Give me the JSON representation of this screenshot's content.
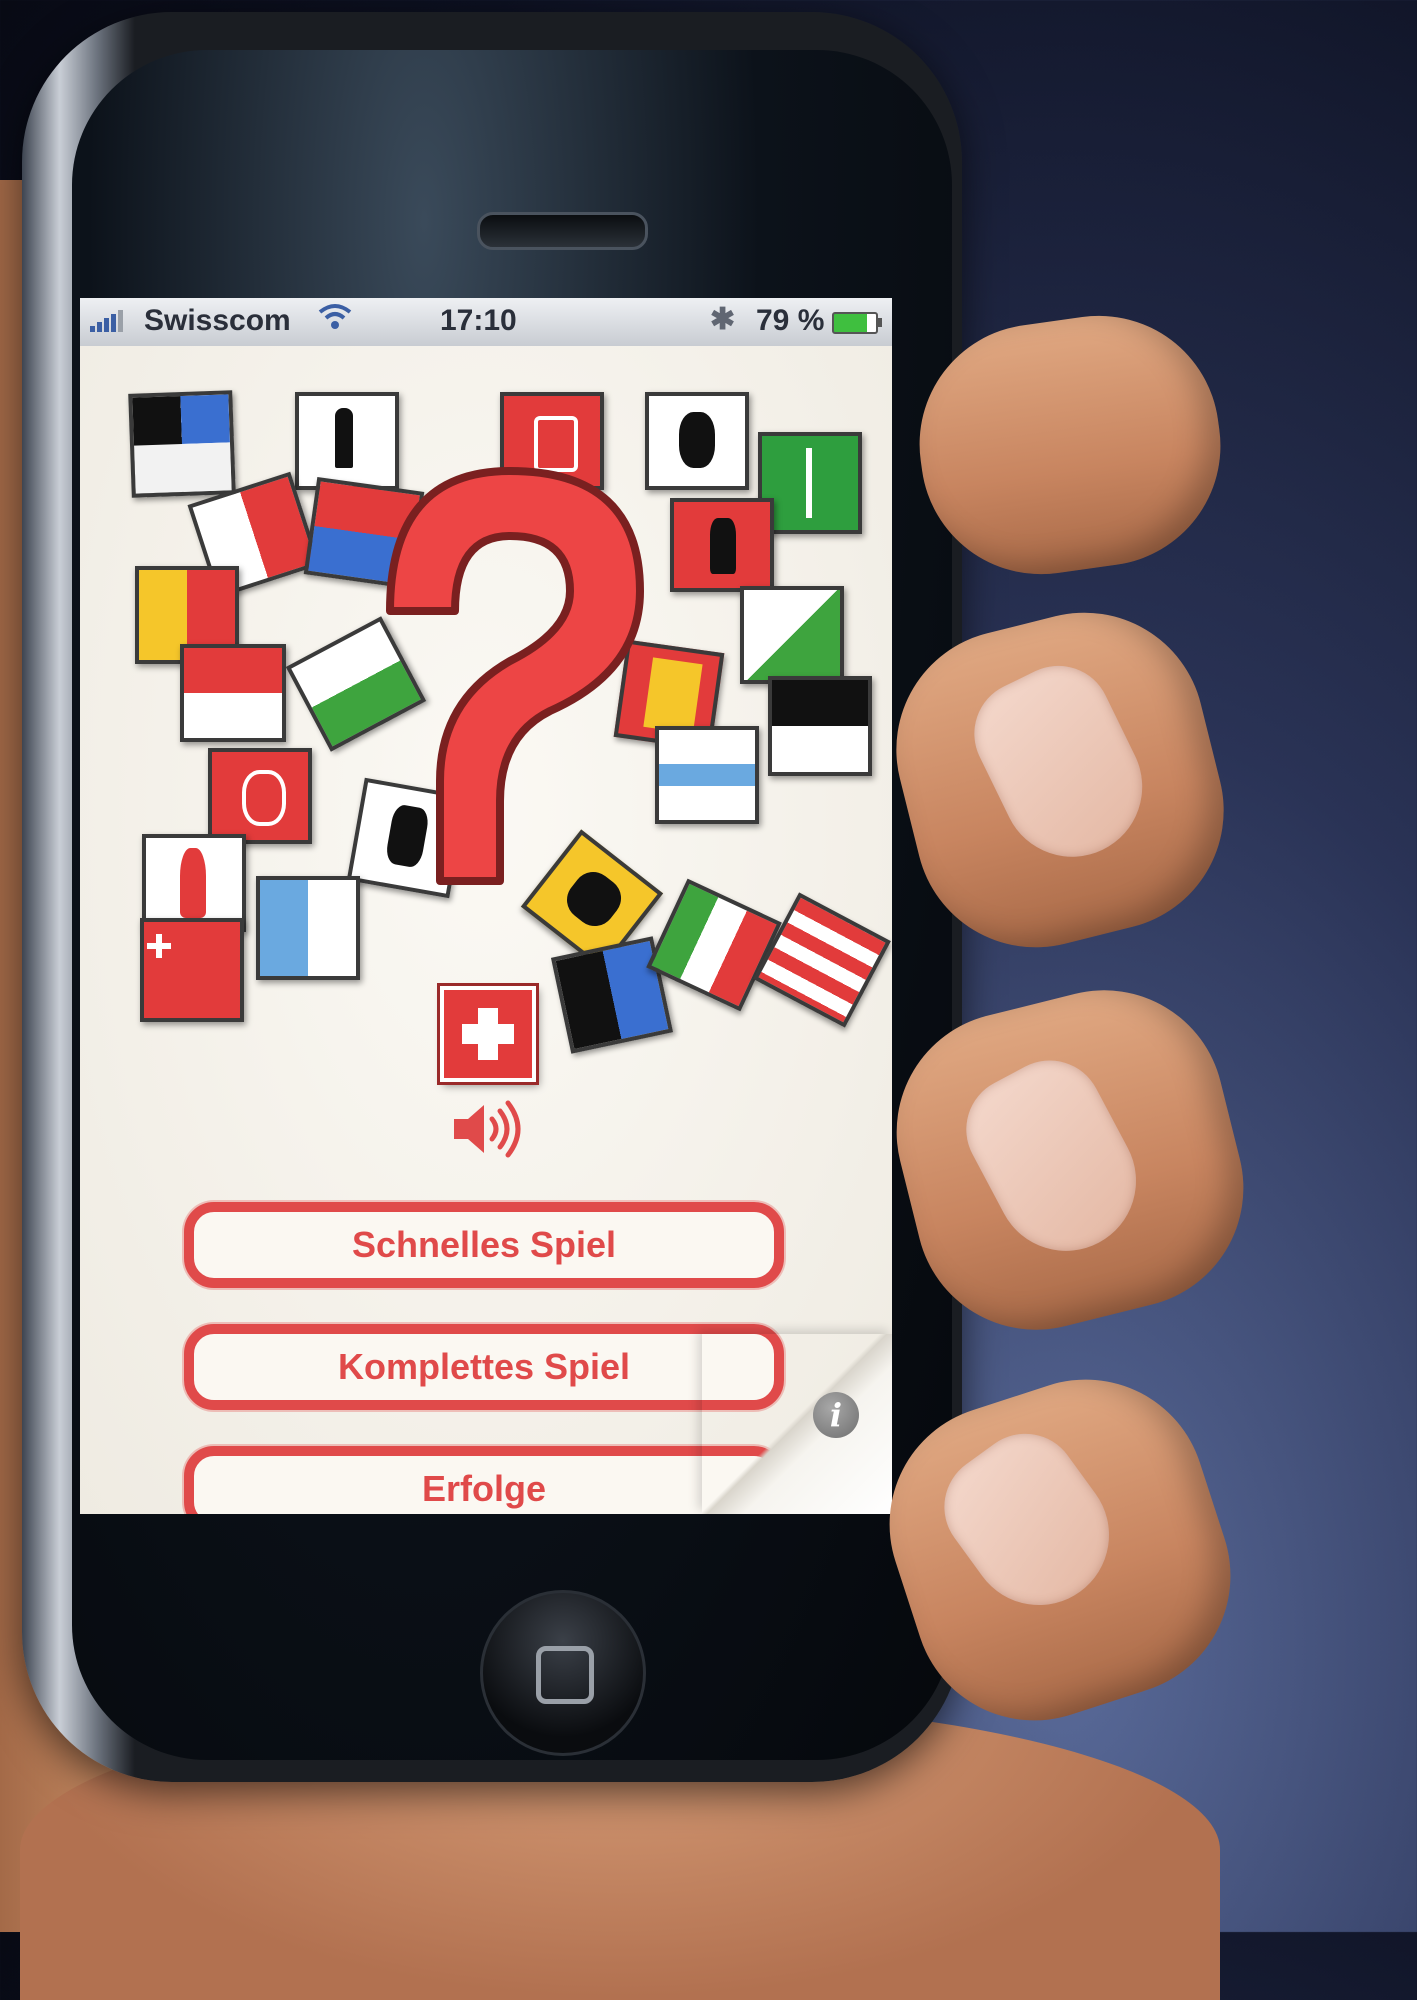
{
  "status_bar": {
    "carrier": "Swisscom",
    "time": "17:10",
    "battery_percent": "79 %",
    "battery_level": 0.79
  },
  "icons": {
    "wifi": "wifi-icon",
    "bluetooth": "bluetooth-icon",
    "sound": "speaker-icon",
    "info": "info-icon",
    "home": "home-button-icon"
  },
  "menu": {
    "items": [
      {
        "label": "Schnelles Spiel"
      },
      {
        "label": "Komplettes Spiel"
      },
      {
        "label": "Erfolge"
      }
    ]
  },
  "info_glyph": "i",
  "colors": {
    "accent": "#e04a4a",
    "background": "#f4f1ea"
  }
}
